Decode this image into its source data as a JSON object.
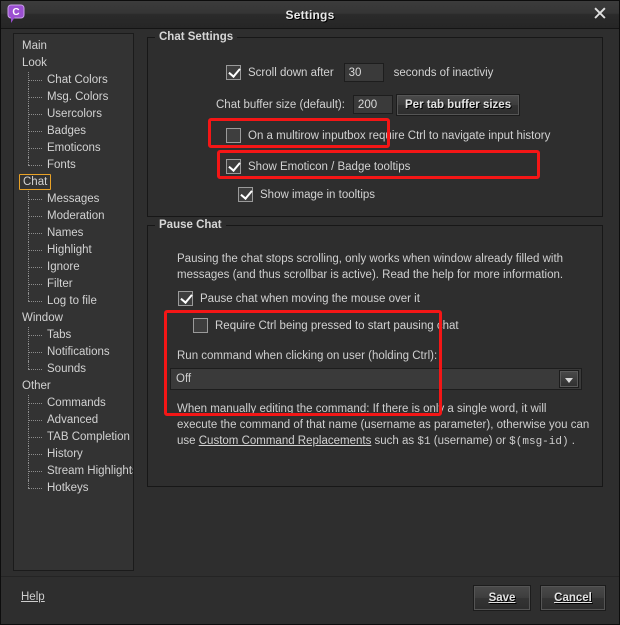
{
  "window": {
    "title": "Settings",
    "app_icon": "chat-bubble-icon",
    "close_icon": "close-icon"
  },
  "sidebar": {
    "items": [
      {
        "label": "Main",
        "level": 0,
        "selected": false
      },
      {
        "label": "Look",
        "level": 0,
        "selected": false
      },
      {
        "label": "Chat Colors",
        "level": 1,
        "selected": false
      },
      {
        "label": "Msg. Colors",
        "level": 1,
        "selected": false
      },
      {
        "label": "Usercolors",
        "level": 1,
        "selected": false
      },
      {
        "label": "Badges",
        "level": 1,
        "selected": false
      },
      {
        "label": "Emoticons",
        "level": 1,
        "selected": false
      },
      {
        "label": "Fonts",
        "level": 1,
        "selected": false,
        "last": true
      },
      {
        "label": "Chat",
        "level": 0,
        "selected": true
      },
      {
        "label": "Messages",
        "level": 1,
        "selected": false
      },
      {
        "label": "Moderation",
        "level": 1,
        "selected": false
      },
      {
        "label": "Names",
        "level": 1,
        "selected": false
      },
      {
        "label": "Highlight",
        "level": 1,
        "selected": false
      },
      {
        "label": "Ignore",
        "level": 1,
        "selected": false
      },
      {
        "label": "Filter",
        "level": 1,
        "selected": false
      },
      {
        "label": "Log to file",
        "level": 1,
        "selected": false,
        "last": true
      },
      {
        "label": "Window",
        "level": 0,
        "selected": false
      },
      {
        "label": "Tabs",
        "level": 1,
        "selected": false
      },
      {
        "label": "Notifications",
        "level": 1,
        "selected": false
      },
      {
        "label": "Sounds",
        "level": 1,
        "selected": false,
        "last": true
      },
      {
        "label": "Other",
        "level": 0,
        "selected": false
      },
      {
        "label": "Commands",
        "level": 1,
        "selected": false
      },
      {
        "label": "Advanced",
        "level": 1,
        "selected": false
      },
      {
        "label": "TAB Completion",
        "level": 1,
        "selected": false
      },
      {
        "label": "History",
        "level": 1,
        "selected": false
      },
      {
        "label": "Stream Highlights",
        "level": 1,
        "selected": false
      },
      {
        "label": "Hotkeys",
        "level": 1,
        "selected": false,
        "last": true
      }
    ]
  },
  "chat_settings": {
    "legend": "Chat Settings",
    "scroll_down": {
      "checked": true,
      "label_before": "Scroll down after",
      "value": "30",
      "label_after": "seconds of inactiviy"
    },
    "buffer_size": {
      "label": "Chat buffer size (default):",
      "value": "200",
      "per_tab_button": "Per tab buffer sizes"
    },
    "multirow_inputbox": {
      "checked": false,
      "label": "On a multirow inputbox require Ctrl to navigate input history"
    },
    "emoticon_tooltips": {
      "checked": true,
      "label": "Show Emoticon / Badge tooltips"
    },
    "image_in_tooltips": {
      "checked": true,
      "label": "Show image in tooltips"
    }
  },
  "pause_chat": {
    "legend": "Pause Chat",
    "description_line1": "Pausing the chat stops scrolling, only works when window already filled with",
    "description_line2": "messages (and thus scrollbar is active). Read the help for more information.",
    "pause_on_hover": {
      "checked": true,
      "label": "Pause chat when moving the mouse over it"
    },
    "require_ctrl": {
      "checked": false,
      "label": "Require Ctrl being pressed to start pausing chat"
    },
    "run_command": {
      "label": "Run command when clicking on user (holding Ctrl):",
      "value": "Off",
      "arrow_icon": "chevron-down-icon"
    },
    "footnote_line1": "When manually editing the command: If there is only a single word, it will",
    "footnote_line2": "execute the command of that name (username as parameter), otherwise you can",
    "footnote_line3_a": "use ",
    "footnote_link": "Custom Command Replacements",
    "footnote_line3_b": " such as ",
    "footnote_code1": "$1",
    "footnote_line3_c": " (username) or ",
    "footnote_code2": "$(msg-id)",
    "footnote_line3_d": " ."
  },
  "footer": {
    "help_label": "Help",
    "save_label": "Save",
    "cancel_label": "Cancel"
  },
  "annotations": {
    "highlight_color": "#f41616",
    "selection_color": "#e9a227"
  }
}
